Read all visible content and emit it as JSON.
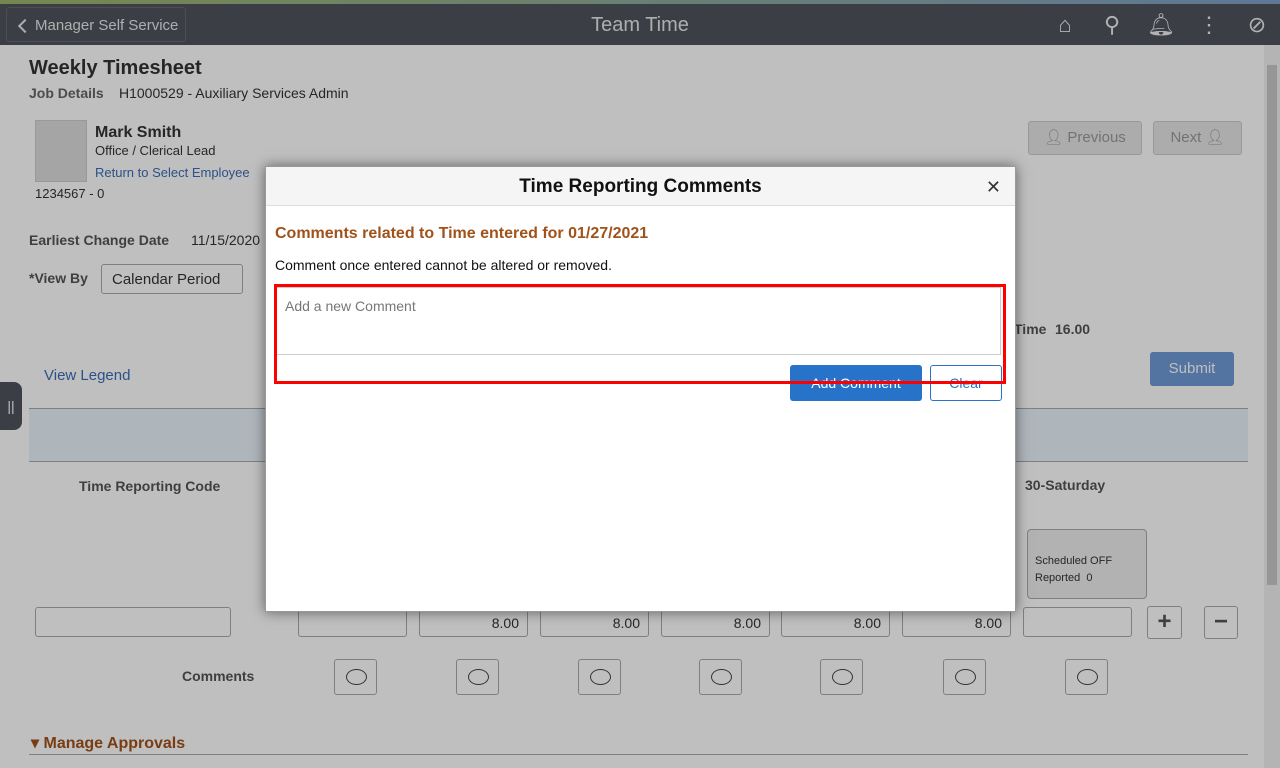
{
  "header": {
    "back_label": "Manager Self Service",
    "title": "Team Time",
    "icons": [
      "home-icon",
      "search-icon",
      "bell-icon",
      "more-vertical-icon",
      "compass-icon"
    ]
  },
  "page": {
    "title": "Weekly Timesheet",
    "job_details_label": "Job Details",
    "job_details_value": "H1000529 - Auxiliary Services Admin",
    "employee": {
      "name": "Mark Smith",
      "title": "Office / Clerical Lead",
      "return_link": "Return to Select Employee",
      "id": "1234567 - 0"
    },
    "previous_label": "Previous",
    "next_label": "Next",
    "earliest_change_label": "Earliest Change Date",
    "earliest_change_value": "11/15/2020",
    "view_by_label": "*View By",
    "view_by_value": "Calendar Period",
    "time_label": "Time",
    "time_value": "16.00",
    "submit_label": "Submit",
    "view_legend": "View Legend",
    "trc_header": "Time Reporting Code",
    "last_day_header": "30-Saturday",
    "last_day_card": {
      "scheduled": "Scheduled OFF",
      "reported_label": "Reported",
      "reported_value": "0"
    },
    "hours": [
      "",
      "8.00",
      "8.00",
      "8.00",
      "8.00",
      "8.00",
      ""
    ],
    "comments_label": "Comments",
    "manage_approvals": "Manage Approvals"
  },
  "modal": {
    "title": "Time Reporting Comments",
    "subtitle": "Comments related to Time entered for 01/27/2021",
    "note": "Comment once entered cannot be altered or removed.",
    "placeholder": "Add a new Comment",
    "add_label": "Add Comment",
    "clear_label": "Clear",
    "accent": "#a0521a"
  }
}
